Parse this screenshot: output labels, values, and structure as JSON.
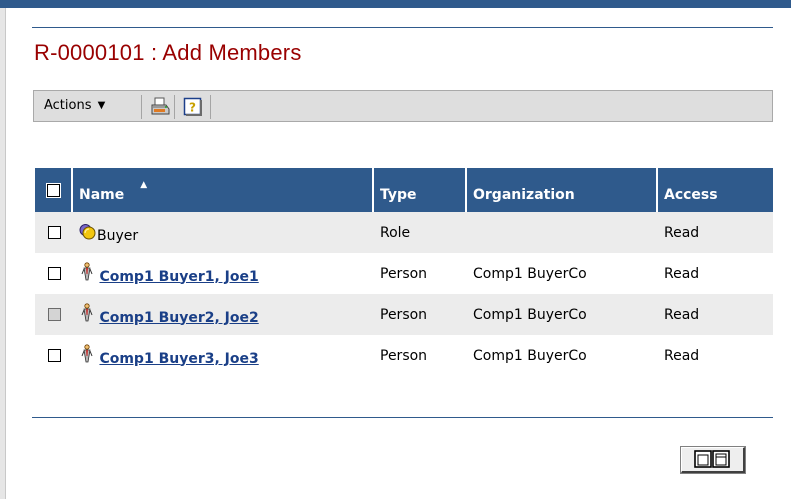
{
  "page": {
    "title": "R-0000101 : Add Members"
  },
  "toolbar": {
    "actions_label": "Actions",
    "actions_caret": "▼",
    "print_icon": "printer-icon",
    "help_icon": "help-icon"
  },
  "table": {
    "columns": [
      "Name",
      "Type",
      "Organization",
      "Access"
    ],
    "sort_indicator": "▲",
    "rows": [
      {
        "icon": "role-icon",
        "name": "Buyer",
        "link": false,
        "type": "Role",
        "organization": "",
        "access": "Read"
      },
      {
        "icon": "person-icon",
        "name": "Comp1 Buyer1, Joe1",
        "link": true,
        "type": "Person",
        "organization": "Comp1 BuyerCo",
        "access": "Read"
      },
      {
        "icon": "person-icon",
        "name": "Comp1 Buyer2, Joe2",
        "link": true,
        "type": "Person",
        "organization": "Comp1 BuyerCo",
        "access": "Read"
      },
      {
        "icon": "person-icon",
        "name": "Comp1 Buyer3, Joe3",
        "link": true,
        "type": "Person",
        "organization": "Comp1 BuyerCo",
        "access": "Read"
      }
    ]
  },
  "footer": {
    "button_icon": "columns-icon"
  },
  "colors": {
    "header": "#2f5a8c",
    "title": "#990000",
    "link": "#1a3f87",
    "row_shade": "#ececec"
  }
}
